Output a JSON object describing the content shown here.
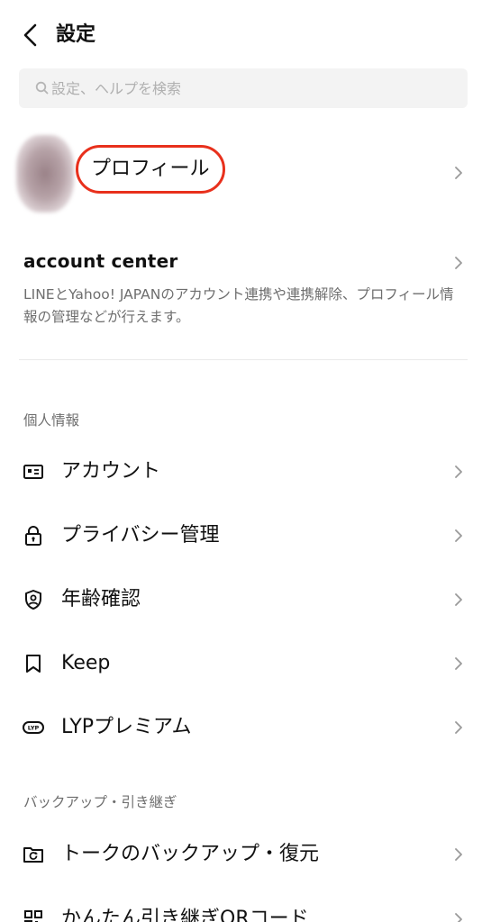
{
  "header": {
    "title": "設定"
  },
  "search": {
    "placeholder": "設定、ヘルプを検索"
  },
  "profile": {
    "label": "プロフィール"
  },
  "account_center": {
    "title": "account center",
    "description": "LINEとYahoo! JAPANのアカウント連携や連携解除、プロフィール情報の管理などが行えます。"
  },
  "sections": {
    "personal": {
      "header": "個人情報",
      "items": [
        {
          "label": "アカウント",
          "icon": "id-card-icon"
        },
        {
          "label": "プライバシー管理",
          "icon": "lock-icon"
        },
        {
          "label": "年齢確認",
          "icon": "shield-person-icon"
        },
        {
          "label": "Keep",
          "icon": "bookmark-icon"
        },
        {
          "label": "LYPプレミアム",
          "icon": "lyp-badge-icon"
        }
      ]
    },
    "backup": {
      "header": "バックアップ・引き継ぎ",
      "items": [
        {
          "label": "トークのバックアップ・復元",
          "icon": "backup-icon"
        },
        {
          "label": "かんたん引き継ぎQRコード",
          "icon": "qr-code-icon"
        }
      ]
    }
  },
  "colors": {
    "highlight_ring": "#e8301c",
    "search_bg": "#f3f3f3",
    "secondary_text": "#6e6e6e"
  }
}
